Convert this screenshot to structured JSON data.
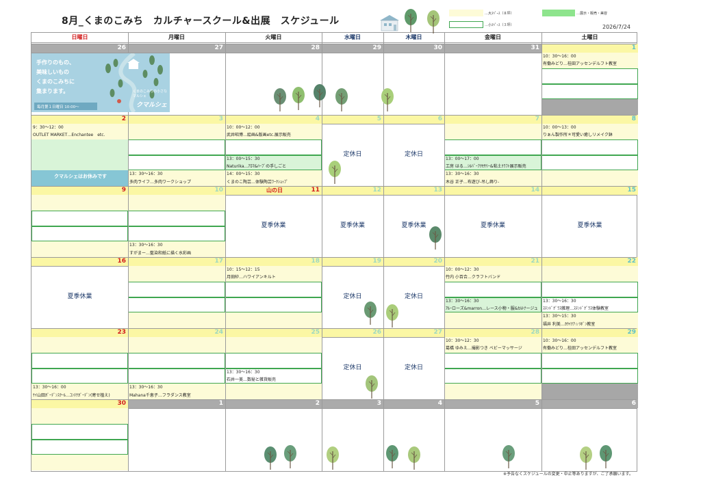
{
  "title": "8月_くまのこみち　カルチャースクール&出展　スケジュール",
  "date": "2026/7/24",
  "legend": {
    "large": "…大ｽﾍﾟｰｽ（８坪）",
    "small": "…小ｽﾍﾟｰｽ（３坪）",
    "exhibit": "…展示・販売・美容"
  },
  "weekdays": [
    "日曜日",
    "月曜日",
    "火曜日",
    "水曜日",
    "木曜日",
    "金曜日",
    "土曜日"
  ],
  "banner": {
    "lines": [
      "手作りのもの、",
      "美味しいもの",
      "くまのこみちに",
      "集まります。"
    ],
    "sub": "くまのこみちの小さなマルシェ",
    "brand": "クマルシェ",
    "bottom": "毎月第１日曜日 10:00～"
  },
  "weeks": [
    {
      "days": [
        "26",
        "27",
        "28",
        "29",
        "30",
        "31",
        "1"
      ]
    },
    {
      "days": [
        "2",
        "3",
        "4",
        "5",
        "6",
        "7",
        "8"
      ]
    },
    {
      "days": [
        "9",
        "10",
        "11",
        "12",
        "13",
        "14",
        "15"
      ],
      "holiday": "山の日"
    },
    {
      "days": [
        "16",
        "17",
        "18",
        "19",
        "20",
        "21",
        "22"
      ]
    },
    {
      "days": [
        "23",
        "24",
        "25",
        "26",
        "27",
        "28",
        "29"
      ]
    },
    {
      "days": [
        "30",
        "1",
        "2",
        "3",
        "4",
        "5",
        "6"
      ]
    }
  ],
  "schedule": {
    "w1_sat_time": "10：30～16：00",
    "w1_sat_text": "有働みどり…桂田アッセンデルフト教室",
    "w2_sun_time": "9：30～12：00",
    "w2_sun_text": "OUTLET MARKET…Enchantee　etc.",
    "w2_sun_closed": "クマルシェはお休みです",
    "w2_mon_time": "13：30～16：30",
    "w2_mon_text": "多肉ライフ…多肉ワークショップ",
    "w2_tue_time1": "10：00～12：00",
    "w2_tue_text1": "武井昭博…絵画&版画etc.展示販売",
    "w2_tue_time2": "13：00～15：30",
    "w2_tue_text2": "Naturika…ｱﾛﾏ&ﾊｰﾌﾞの手しごと",
    "w2_tue_time3": "14：00～15：30",
    "w2_tue_text3": "くまのこ陶芸…体験陶芸ﾜｰｸｼｮｯﾌﾟ",
    "w2_wed": "定休日",
    "w2_thu": "定休日",
    "w2_fri_time1": "13：00～17：00",
    "w2_fri_text1": "工房 はる…ｼﾙﾊﾞｰｱｸｾｻﾘｰ&粘土ｸﾗﾌﾄ展示販売",
    "w2_fri_time2": "13：30～16：30",
    "w2_fri_text2": "木谷 正子…布遊び-吊し飾り-",
    "w2_sat_time": "10：00～13：00",
    "w2_sat_text": "りぁん製作所＊可愛い癒しリメイク鉢",
    "w3_mon_time": "13：30～16：30",
    "w3_mon_text": "すがまー…藍染和紙に描く水彩画",
    "w3_summer": "夏季休業",
    "w4_sun": "夏季休業",
    "w4_tue_time": "10：15～12：15",
    "w4_tue_text": "月田紗…ハワイアンキルト",
    "w4_wed": "定休日",
    "w4_thu": "定休日",
    "w4_fri_time1": "10：00～12：30",
    "w4_fri_text1": "竹内 小百合…クラフトバンド",
    "w4_fri_time2": "13：30～16：30",
    "w4_fri_text2": "ｱﾙｰローズ&marron…レース小物・服&ｶﾙﾄﾅージュ",
    "w4_sat_time1": "13：30～16：30",
    "w4_sat_text1": "ｽﾃﾝﾄﾞｸﾞﾗｽ雑理…ｽﾃﾝﾄﾞｸﾞﾗｽ体験教室",
    "w4_sat_time2": "13：30～15：30",
    "w4_sat_text2": "福井 利美…ｶｳｲｸｱ☆ﾘﾎﾞﾝ教室",
    "w5_sun_time": "13：30～16：00",
    "w5_sun_text": "ｹｲ山田ｶﾞｰﾃﾞﾝｽｸｰﾙ…ｺﾝﾃﾅｶﾞｰﾃﾞﾝ(寄せ植え)",
    "w5_mon_time": "13：30～16：30",
    "w5_mon_text": "Mahana千恵子…フラダンス教室",
    "w5_tue_time": "13：30～16：30",
    "w5_tue_text": "石井一美…数秘と雑貨販売",
    "w5_wed": "定休日",
    "w5_thu": "定休日",
    "w5_fri_time": "10：30～12：30",
    "w5_fri_text": "葛橋 ゆみえ…撮影つき ベビーマッサージ",
    "w5_sat_time": "10：30～16：00",
    "w5_sat_text": "有働みどり…桂田アッセンデルフト教室"
  },
  "footer": "※予告なくスケジュールの変更・中止等ありますが、ご了承願います。",
  "colors": {
    "yellow": "#fbf7a4",
    "lightyellow": "#fdfbd7",
    "green": "#d9f4d8",
    "accent": "#3ea64f",
    "red": "#d21e1e",
    "teal": "#5ec0c8",
    "gray": "#ababab",
    "closedblue": "#86c6d5"
  }
}
